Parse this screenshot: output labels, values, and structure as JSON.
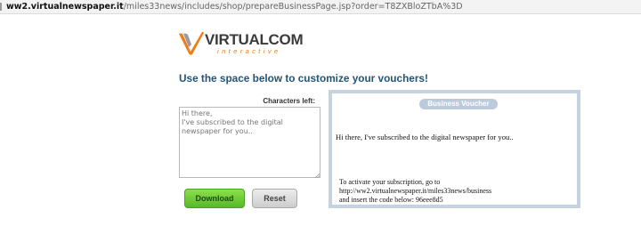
{
  "browser": {
    "url_host": "ww2.virtualnewspaper.it",
    "url_path": "/miles33news/includes/shop/prepareBusinessPage.jsp?order=T8ZXBloZTbA%3D"
  },
  "logo": {
    "name": "VIRTUALCOM",
    "tagline": "interactive",
    "icon": "v-swoosh-logo-icon"
  },
  "heading": "Use the space below to customize your vouchers!",
  "editor": {
    "chars_left_label": "Characters left:",
    "value": "Hi there,\nI've subscribed to the digital newspaper for you..",
    "icon": "resize-grip-icon"
  },
  "buttons": {
    "download": "Download",
    "reset": "Reset"
  },
  "voucher": {
    "badge": "Business Voucher",
    "message": "Hi there, I've subscribed to the digital newspaper for you..",
    "footer": [
      "To activate your subscription, go to",
      "http://ww2.virtualnewspaper.it/miles33news/business",
      "and insert the code below: 96eee8d5"
    ]
  },
  "colors": {
    "heading": "#225577",
    "download_green": "#58b82a",
    "voucher_border": "#c5d2e0",
    "badge_bg": "#bccbdc",
    "logo_orange": "#ef7d16"
  }
}
